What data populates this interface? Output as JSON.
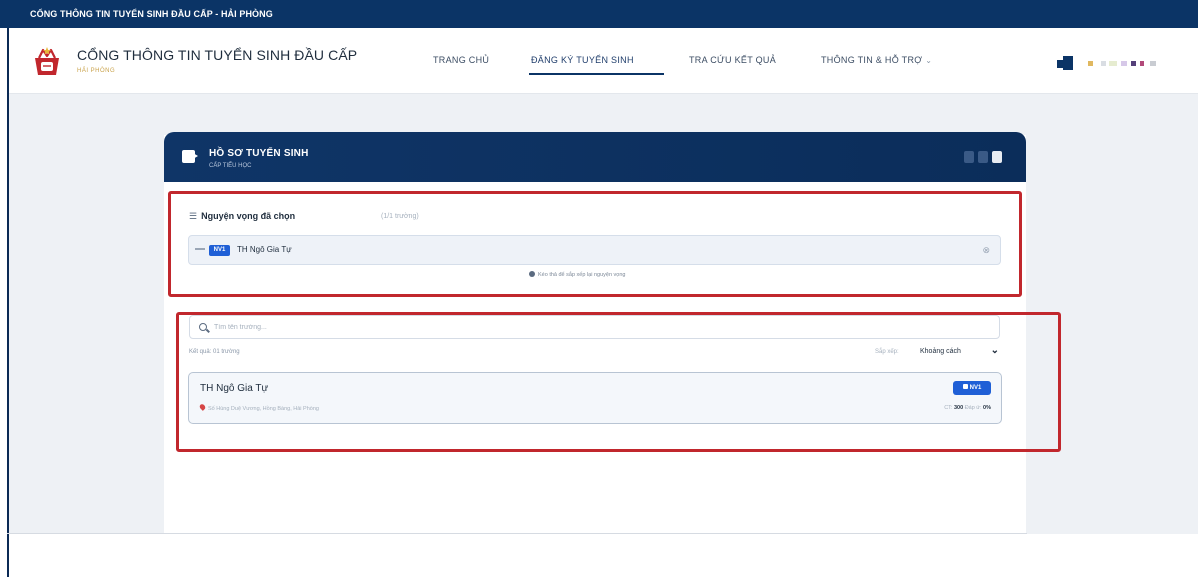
{
  "topbar": {
    "text": "CỔNG THÔNG TIN TUYỂN SINH ĐẦU CẤP - HẢI PHÒNG"
  },
  "header": {
    "brand_title": "CỔNG THÔNG TIN TUYỂN SINH ĐẦU CẤP",
    "brand_sub": "HẢI PHÒNG",
    "nav": [
      {
        "label": "TRANG CHỦ"
      },
      {
        "label": "ĐĂNG KÝ TUYỂN SINH",
        "active": true
      },
      {
        "label": "TRA CỨU KẾT QUẢ"
      },
      {
        "label": "THÔNG TIN & HỖ TRỢ"
      }
    ]
  },
  "panel": {
    "title": "HỒ SƠ TUYỂN SINH",
    "subtitle": "CẤP TIỂU HỌC"
  },
  "chosen": {
    "title": "Nguyện vọng đã chọn",
    "count": "(1/1 trường)",
    "items": [
      {
        "badge": "NV1",
        "name": "TH Ngô Gia Tự"
      }
    ],
    "hint": "Kéo thả để sắp xếp lại nguyện vọng"
  },
  "search": {
    "placeholder": "Tìm tên trường...",
    "result_count": "Kết quả: 01 trường",
    "sort_label": "Sắp xếp:",
    "sort_value": "Khoảng cách"
  },
  "schools": [
    {
      "name": "TH Ngô Gia Tự",
      "address": "Số Hùng Duệ Vương, Hồng Bàng, Hải Phòng",
      "badge": "NV1",
      "ct_label": "CT:",
      "ct_value": "300",
      "status_label": "Đáp ứ:",
      "status_value": "0%"
    }
  ],
  "colors": {
    "primary": "#0b3466",
    "accent_blue": "#1f5fd6",
    "annotation_red": "#c1272d"
  }
}
